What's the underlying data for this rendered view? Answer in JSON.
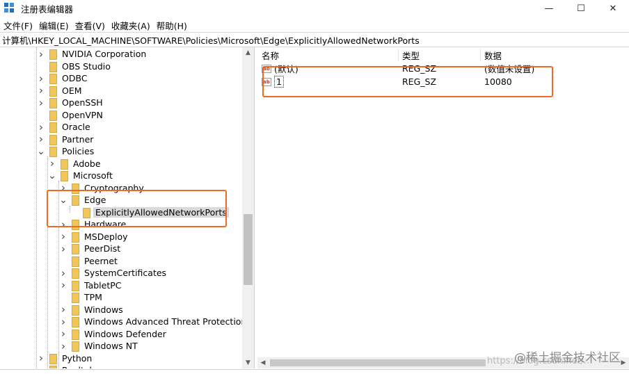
{
  "window": {
    "title": "注册表编辑器",
    "controls": {
      "minimize": "—",
      "maximize": "☐",
      "close": "✕"
    }
  },
  "menu": [
    "文件(F)",
    "编辑(E)",
    "查看(V)",
    "收藏夹(A)",
    "帮助(H)"
  ],
  "address": "计算机\\HKEY_LOCAL_MACHINE\\SOFTWARE\\Policies\\Microsoft\\Edge\\ExplicitlyAllowedNetworkPorts",
  "tree": [
    {
      "label": "NVIDIA Corporation",
      "level": 0,
      "chevron": ">"
    },
    {
      "label": "OBS Studio",
      "level": 0,
      "chevron": ""
    },
    {
      "label": "ODBC",
      "level": 0,
      "chevron": ">"
    },
    {
      "label": "OEM",
      "level": 0,
      "chevron": ">"
    },
    {
      "label": "OpenSSH",
      "level": 0,
      "chevron": ">"
    },
    {
      "label": "OpenVPN",
      "level": 0,
      "chevron": ""
    },
    {
      "label": "Oracle",
      "level": 0,
      "chevron": ">"
    },
    {
      "label": "Partner",
      "level": 0,
      "chevron": ">"
    },
    {
      "label": "Policies",
      "level": 0,
      "chevron": "v"
    },
    {
      "label": "Adobe",
      "level": 1,
      "chevron": ">"
    },
    {
      "label": "Microsoft",
      "level": 1,
      "chevron": "v"
    },
    {
      "label": "Cryptography",
      "level": 2,
      "chevron": ">"
    },
    {
      "label": "Edge",
      "level": 2,
      "chevron": "v"
    },
    {
      "label": "ExplicitlyAllowedNetworkPorts",
      "level": 3,
      "chevron": ""
    },
    {
      "label": "Hardware",
      "level": 2,
      "chevron": ">"
    },
    {
      "label": "MSDeploy",
      "level": 2,
      "chevron": ">"
    },
    {
      "label": "PeerDist",
      "level": 2,
      "chevron": ">"
    },
    {
      "label": "Peernet",
      "level": 2,
      "chevron": ""
    },
    {
      "label": "SystemCertificates",
      "level": 2,
      "chevron": ">"
    },
    {
      "label": "TabletPC",
      "level": 2,
      "chevron": ">"
    },
    {
      "label": "TPM",
      "level": 2,
      "chevron": ""
    },
    {
      "label": "Windows",
      "level": 2,
      "chevron": ">"
    },
    {
      "label": "Windows Advanced Threat Protection",
      "level": 2,
      "chevron": ">"
    },
    {
      "label": "Windows Defender",
      "level": 2,
      "chevron": ">"
    },
    {
      "label": "Windows NT",
      "level": 2,
      "chevron": ">"
    },
    {
      "label": "Python",
      "level": 0,
      "chevron": ">"
    },
    {
      "label": "Realtek",
      "level": 0,
      "chevron": ">"
    }
  ],
  "values": {
    "headers": {
      "name": "名称",
      "type": "类型",
      "data": "数据"
    },
    "rows": [
      {
        "name": "(默认)",
        "type": "REG_SZ",
        "data": "(数值未设置)"
      },
      {
        "name": "1",
        "type": "REG_SZ",
        "data": "10080"
      }
    ]
  },
  "watermark": {
    "text": "@稀土掘金技术社区",
    "url": "https://blog.csdn.net/..."
  },
  "colors": {
    "annotation": "#f06a24",
    "folder": "#f2c45a"
  }
}
